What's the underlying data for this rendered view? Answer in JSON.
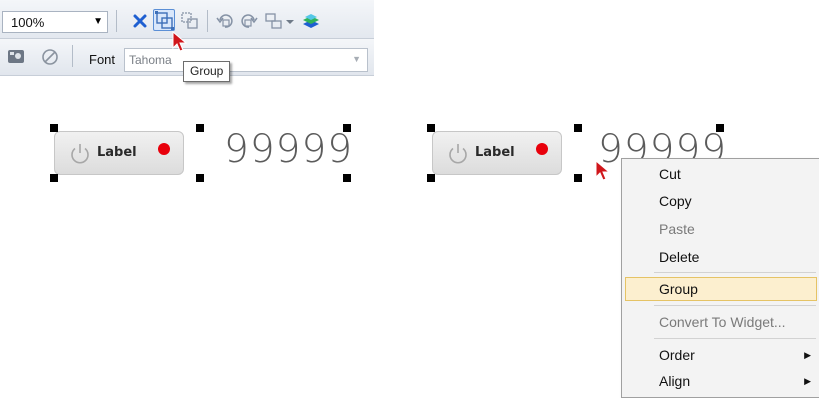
{
  "toolbar": {
    "zoom_value": "100%",
    "zoom_arrow": "▼",
    "icons_row1": [
      "close-icon",
      "group-icon",
      "ungroup-icon",
      "rotate-left-icon",
      "rotate-right-icon",
      "align-icon",
      "align-dropdown-arrow-icon",
      "layer-order-icon"
    ],
    "icons_row2": [
      "image-icon",
      "disabled-icon"
    ],
    "font_label": "Font",
    "font_value": "Tahoma",
    "font_arrow": "▼",
    "tooltip": "Group"
  },
  "canvas": {
    "switch_left": {
      "label": "Label",
      "icon": "power-icon"
    },
    "number_left": "99999",
    "switch_right": {
      "label": "Label",
      "icon": "power-icon"
    },
    "number_right": "99999"
  },
  "context_menu": {
    "items": [
      {
        "label": "Cut",
        "enabled": true
      },
      {
        "label": "Copy",
        "enabled": true
      },
      {
        "label": "Paste",
        "enabled": false
      },
      {
        "label": "Delete",
        "enabled": true
      },
      {
        "label": "Group",
        "enabled": true,
        "highlighted": true
      },
      {
        "label": "Convert To Widget...",
        "enabled": false
      },
      {
        "label": "Order",
        "enabled": true,
        "submenu": true
      },
      {
        "label": "Align",
        "enabled": true,
        "submenu": true
      }
    ],
    "submenu_arrow": "▶"
  },
  "colors": {
    "accent_blue": "#1e5fd1",
    "status_dot_red": "#e8000b",
    "menu_highlight": "#fcefcf",
    "cursor_red": "#d0161b"
  }
}
